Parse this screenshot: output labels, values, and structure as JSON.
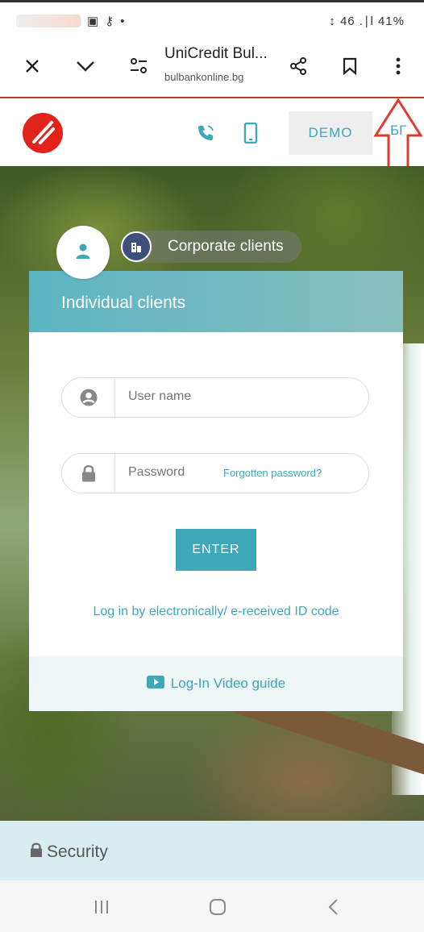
{
  "status_bar": {
    "right": "↕ 46 .∣l 41%"
  },
  "browser": {
    "title": "UniCredit Bul...",
    "url": "bulbankonline.bg"
  },
  "header": {
    "demo_label": "DEMO",
    "lang_label": "БГ"
  },
  "tabs": {
    "corporate_label": "Corporate clients",
    "individual_label": "Individual clients"
  },
  "login": {
    "username_placeholder": "User name",
    "password_placeholder": "Password",
    "forgot_label": "Forgotten password?",
    "enter_label": "ENTER",
    "eid_link": "Log in by electronically/ e-received ID code",
    "video_label": "Log-In Video guide"
  },
  "security": {
    "label": "Security"
  },
  "colors": {
    "accent": "#3fa7b8",
    "brand_red": "#e2231a",
    "annotation_red": "#e03a2f"
  },
  "icons": [
    "close-icon",
    "chevron-down-icon",
    "site-settings-icon",
    "share-icon",
    "bookmark-icon",
    "more-vert-icon",
    "phone-icon",
    "mobile-icon",
    "user-icon",
    "building-icon",
    "user-circle-icon",
    "lock-icon",
    "video-icon",
    "recents-icon",
    "home-icon",
    "back-icon"
  ]
}
